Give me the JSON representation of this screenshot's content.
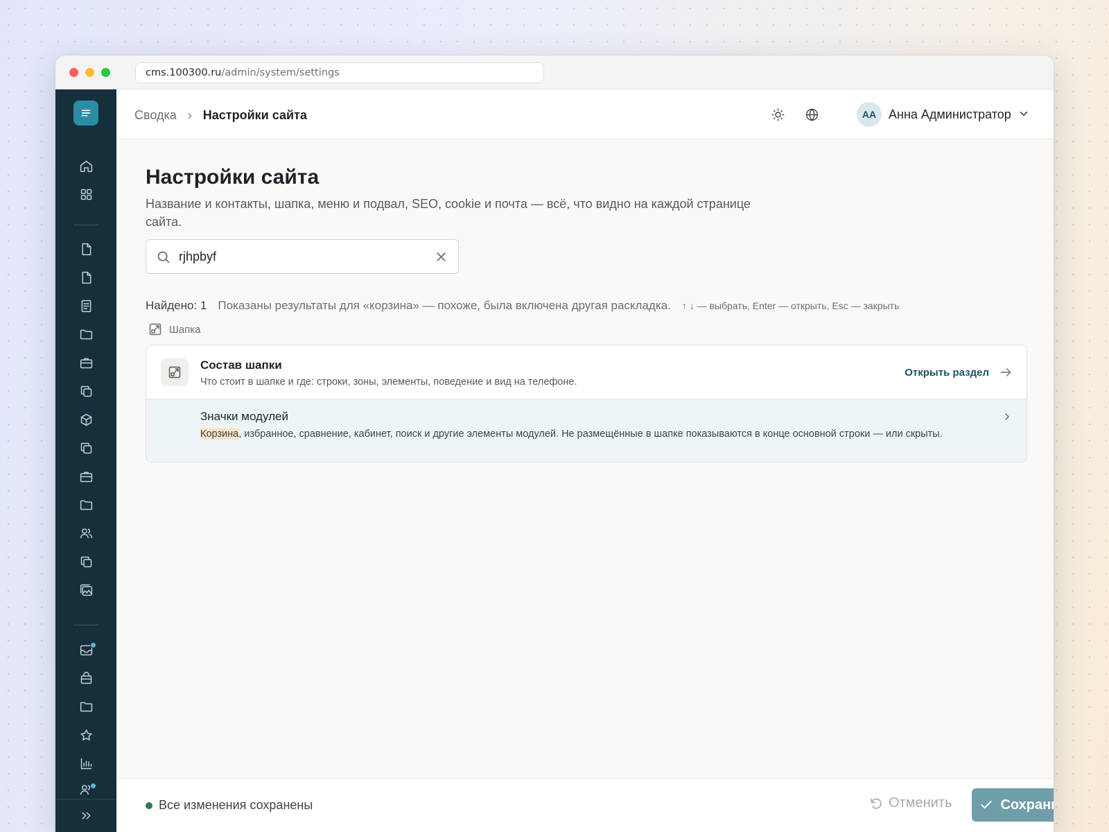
{
  "browser": {
    "url_host": "cms.100300.ru",
    "url_path": "/admin/system/settings"
  },
  "sidebar": {
    "icons": [
      "home-icon",
      "apps-icon",
      "file-icon",
      "file-icon",
      "list-icon",
      "folder-icon",
      "briefcase-icon",
      "layers-icon",
      "box-icon",
      "layers-icon",
      "briefcase-icon",
      "folder-icon",
      "users-icon",
      "layers-icon",
      "gallery-icon",
      "inbox-icon",
      "bag-icon",
      "folder-icon",
      "star-icon",
      "chart-icon",
      "users-icon",
      "expand-icon"
    ],
    "accent": "#2b8da5",
    "background": "#15303a"
  },
  "header": {
    "breadcrumb_root": "Сводка",
    "breadcrumb_current": "Настройки сайта",
    "avatar_initials": "AA",
    "user_name": "Анна Администратор"
  },
  "page": {
    "title": "Настройки сайта",
    "description": "Название и контакты, шапка, меню и подвал, SEO, cookie и почта — всё, что видно на каждой странице сайта."
  },
  "search": {
    "value": "rjhpbyf",
    "found": "Найдено: 1",
    "hint": "Показаны результаты для «корзина» — похоже, была включена другая раскладка.",
    "keys_hint": "↑ ↓ — выбрать, Enter — открыть, Esc — закрыть"
  },
  "results": {
    "group_label": "Шапка",
    "section_title": "Состав шапки",
    "section_subtitle": "Что стоит в шапке и где: строки, зоны, элементы, поведение и вид на телефоне.",
    "open_link": "Открыть раздел",
    "item_title": "Значки модулей",
    "item_highlight": "Корзина",
    "item_desc_rest": ", избранное, сравнение, кабинет, поиск и другие элементы модулей. Не размещённые в шапке показываются в конце основной строки — или скрыты."
  },
  "footer": {
    "status": "Все изменения сохранены",
    "status_color": "#2f7a4a",
    "cancel_label": "Отменить",
    "save_label": "Сохранить",
    "save_color": "#6f9eab"
  }
}
